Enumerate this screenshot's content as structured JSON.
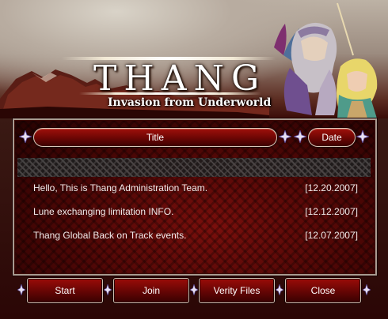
{
  "banner": {
    "logo_text": "THANG",
    "subtitle": "Invasion from Underworld"
  },
  "table": {
    "title_header": "Title",
    "date_header": "Date",
    "rows": [
      {
        "title": "Hello, This is Thang Administration Team.",
        "date": "[12.20.2007]"
      },
      {
        "title": "Lune exchanging limitation INFO.",
        "date": "[12.12.2007]"
      },
      {
        "title": "Thang Global Back on Track events.",
        "date": "[12.07.2007]"
      }
    ]
  },
  "footer": {
    "start_label": "Start",
    "join_label": "Join",
    "verify_label": "Verity Files",
    "close_label": "Close"
  },
  "colors": {
    "panel_red": "#4a0605",
    "button_red": "#6b0604",
    "frame": "#a89a90",
    "text": "#ffffff"
  },
  "icons": [
    "star-ornament-icon"
  ]
}
